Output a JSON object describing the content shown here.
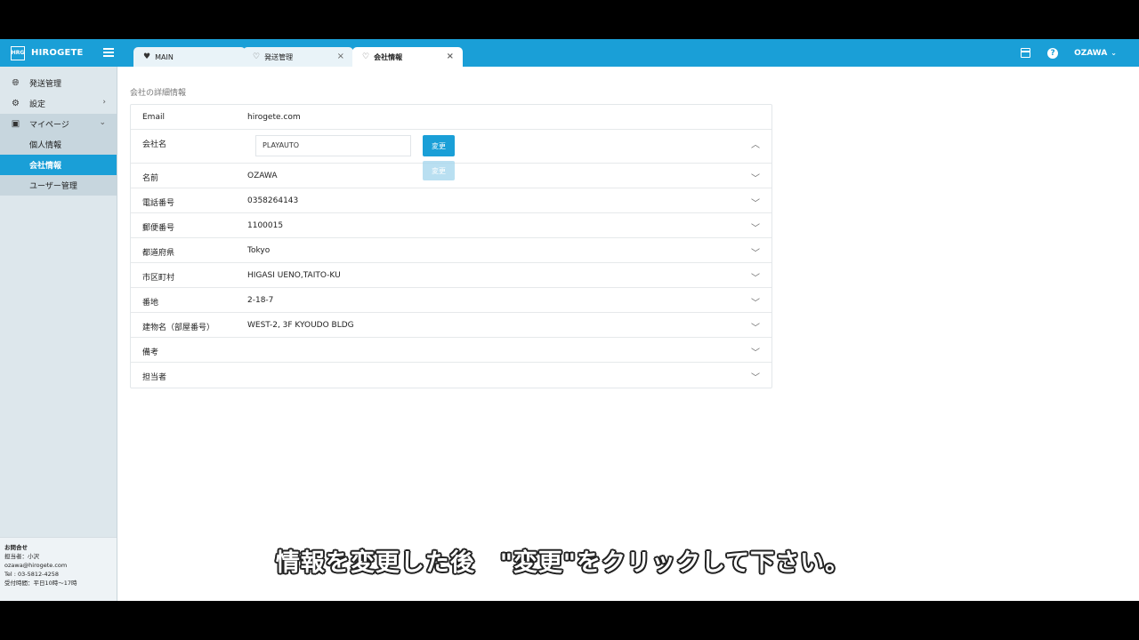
{
  "app": {
    "brand_logo": "HRG",
    "brand_name": "HIROGETE"
  },
  "tabs": [
    {
      "label": "MAIN"
    },
    {
      "label": "発送管理",
      "close": "×"
    },
    {
      "label": "会社情報",
      "close": "×"
    }
  ],
  "header": {
    "help_glyph": "?",
    "user": "OZAWA",
    "user_chevron": "⌄"
  },
  "sidebar": {
    "items": [
      {
        "label": "発送管理"
      },
      {
        "label": "設定",
        "arrow": "›"
      },
      {
        "label": "マイページ",
        "arrow": "⌄"
      }
    ],
    "sub_items": [
      {
        "label": "個人情報"
      },
      {
        "label": "会社情報"
      },
      {
        "label": "ユーザー管理"
      }
    ]
  },
  "contact": {
    "title": "お問合せ",
    "person": "担当者：小沢",
    "email": "ozawa@hirogete.com",
    "tel": "Tel : 03-5812-4258",
    "hours": "受付時間：平日10時〜17時"
  },
  "page": {
    "title": "会社の詳細情報",
    "rows": [
      {
        "label": "Email",
        "value": "hirogete.com"
      },
      {
        "label": "会社名",
        "value": "PLAYAUTO",
        "input_value": "PLAYAUTO",
        "button": "変更",
        "expanded": true
      },
      {
        "label": "名前",
        "value": "OZAWA"
      },
      {
        "label": "電話番号",
        "value": "0358264143"
      },
      {
        "label": "郵便番号",
        "value": "1100015"
      },
      {
        "label": "都道府県",
        "value": "Tokyo"
      },
      {
        "label": "市区町村",
        "value": "HIGASI UENO,TAITO-KU"
      },
      {
        "label": "番地",
        "value": "2-18-7"
      },
      {
        "label": "建物名（部屋番号）",
        "value": "WEST-2, 3F KYOUDO BLDG"
      },
      {
        "label": "備考",
        "value": ""
      },
      {
        "label": "担当者",
        "value": ""
      }
    ],
    "ghost_button": "変更"
  },
  "subtitle": "情報を変更した後　\"変更\"をクリックして下さい。",
  "colors": {
    "accent": "#1a9fd7",
    "sidebar_bg": "#dde7ec"
  }
}
